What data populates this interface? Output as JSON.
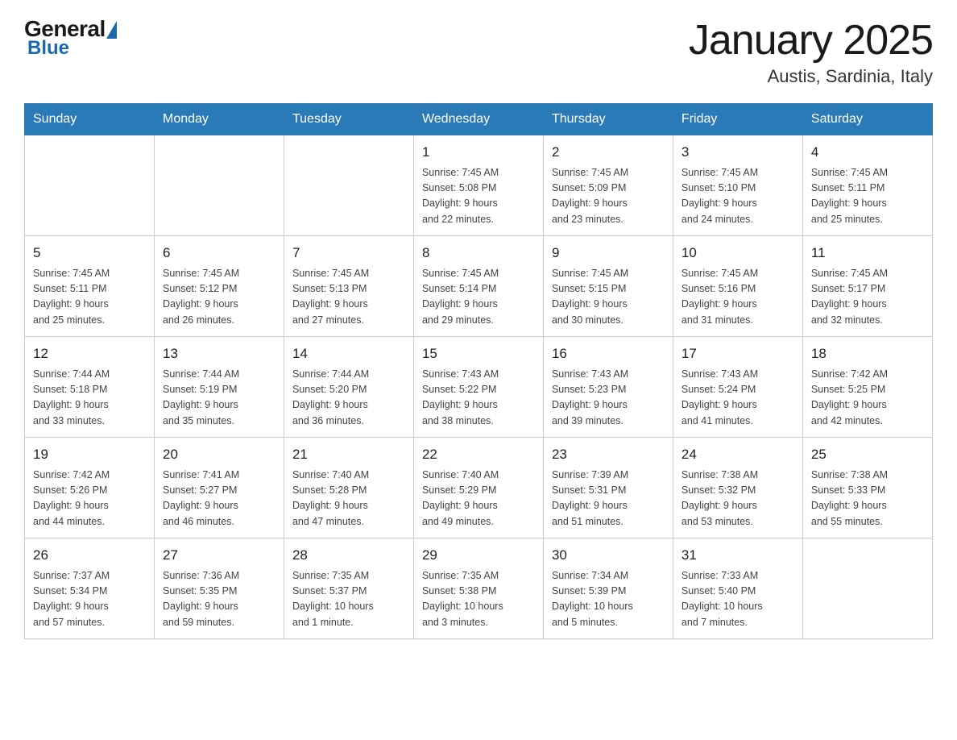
{
  "header": {
    "logo": {
      "general": "General",
      "blue": "Blue",
      "triangle_color": "#1a6aab"
    },
    "title": "January 2025",
    "subtitle": "Austis, Sardinia, Italy"
  },
  "days_of_week": [
    "Sunday",
    "Monday",
    "Tuesday",
    "Wednesday",
    "Thursday",
    "Friday",
    "Saturday"
  ],
  "weeks": [
    [
      {
        "day": "",
        "info": ""
      },
      {
        "day": "",
        "info": ""
      },
      {
        "day": "",
        "info": ""
      },
      {
        "day": "1",
        "info": "Sunrise: 7:45 AM\nSunset: 5:08 PM\nDaylight: 9 hours\nand 22 minutes."
      },
      {
        "day": "2",
        "info": "Sunrise: 7:45 AM\nSunset: 5:09 PM\nDaylight: 9 hours\nand 23 minutes."
      },
      {
        "day": "3",
        "info": "Sunrise: 7:45 AM\nSunset: 5:10 PM\nDaylight: 9 hours\nand 24 minutes."
      },
      {
        "day": "4",
        "info": "Sunrise: 7:45 AM\nSunset: 5:11 PM\nDaylight: 9 hours\nand 25 minutes."
      }
    ],
    [
      {
        "day": "5",
        "info": "Sunrise: 7:45 AM\nSunset: 5:11 PM\nDaylight: 9 hours\nand 25 minutes."
      },
      {
        "day": "6",
        "info": "Sunrise: 7:45 AM\nSunset: 5:12 PM\nDaylight: 9 hours\nand 26 minutes."
      },
      {
        "day": "7",
        "info": "Sunrise: 7:45 AM\nSunset: 5:13 PM\nDaylight: 9 hours\nand 27 minutes."
      },
      {
        "day": "8",
        "info": "Sunrise: 7:45 AM\nSunset: 5:14 PM\nDaylight: 9 hours\nand 29 minutes."
      },
      {
        "day": "9",
        "info": "Sunrise: 7:45 AM\nSunset: 5:15 PM\nDaylight: 9 hours\nand 30 minutes."
      },
      {
        "day": "10",
        "info": "Sunrise: 7:45 AM\nSunset: 5:16 PM\nDaylight: 9 hours\nand 31 minutes."
      },
      {
        "day": "11",
        "info": "Sunrise: 7:45 AM\nSunset: 5:17 PM\nDaylight: 9 hours\nand 32 minutes."
      }
    ],
    [
      {
        "day": "12",
        "info": "Sunrise: 7:44 AM\nSunset: 5:18 PM\nDaylight: 9 hours\nand 33 minutes."
      },
      {
        "day": "13",
        "info": "Sunrise: 7:44 AM\nSunset: 5:19 PM\nDaylight: 9 hours\nand 35 minutes."
      },
      {
        "day": "14",
        "info": "Sunrise: 7:44 AM\nSunset: 5:20 PM\nDaylight: 9 hours\nand 36 minutes."
      },
      {
        "day": "15",
        "info": "Sunrise: 7:43 AM\nSunset: 5:22 PM\nDaylight: 9 hours\nand 38 minutes."
      },
      {
        "day": "16",
        "info": "Sunrise: 7:43 AM\nSunset: 5:23 PM\nDaylight: 9 hours\nand 39 minutes."
      },
      {
        "day": "17",
        "info": "Sunrise: 7:43 AM\nSunset: 5:24 PM\nDaylight: 9 hours\nand 41 minutes."
      },
      {
        "day": "18",
        "info": "Sunrise: 7:42 AM\nSunset: 5:25 PM\nDaylight: 9 hours\nand 42 minutes."
      }
    ],
    [
      {
        "day": "19",
        "info": "Sunrise: 7:42 AM\nSunset: 5:26 PM\nDaylight: 9 hours\nand 44 minutes."
      },
      {
        "day": "20",
        "info": "Sunrise: 7:41 AM\nSunset: 5:27 PM\nDaylight: 9 hours\nand 46 minutes."
      },
      {
        "day": "21",
        "info": "Sunrise: 7:40 AM\nSunset: 5:28 PM\nDaylight: 9 hours\nand 47 minutes."
      },
      {
        "day": "22",
        "info": "Sunrise: 7:40 AM\nSunset: 5:29 PM\nDaylight: 9 hours\nand 49 minutes."
      },
      {
        "day": "23",
        "info": "Sunrise: 7:39 AM\nSunset: 5:31 PM\nDaylight: 9 hours\nand 51 minutes."
      },
      {
        "day": "24",
        "info": "Sunrise: 7:38 AM\nSunset: 5:32 PM\nDaylight: 9 hours\nand 53 minutes."
      },
      {
        "day": "25",
        "info": "Sunrise: 7:38 AM\nSunset: 5:33 PM\nDaylight: 9 hours\nand 55 minutes."
      }
    ],
    [
      {
        "day": "26",
        "info": "Sunrise: 7:37 AM\nSunset: 5:34 PM\nDaylight: 9 hours\nand 57 minutes."
      },
      {
        "day": "27",
        "info": "Sunrise: 7:36 AM\nSunset: 5:35 PM\nDaylight: 9 hours\nand 59 minutes."
      },
      {
        "day": "28",
        "info": "Sunrise: 7:35 AM\nSunset: 5:37 PM\nDaylight: 10 hours\nand 1 minute."
      },
      {
        "day": "29",
        "info": "Sunrise: 7:35 AM\nSunset: 5:38 PM\nDaylight: 10 hours\nand 3 minutes."
      },
      {
        "day": "30",
        "info": "Sunrise: 7:34 AM\nSunset: 5:39 PM\nDaylight: 10 hours\nand 5 minutes."
      },
      {
        "day": "31",
        "info": "Sunrise: 7:33 AM\nSunset: 5:40 PM\nDaylight: 10 hours\nand 7 minutes."
      },
      {
        "day": "",
        "info": ""
      }
    ]
  ]
}
